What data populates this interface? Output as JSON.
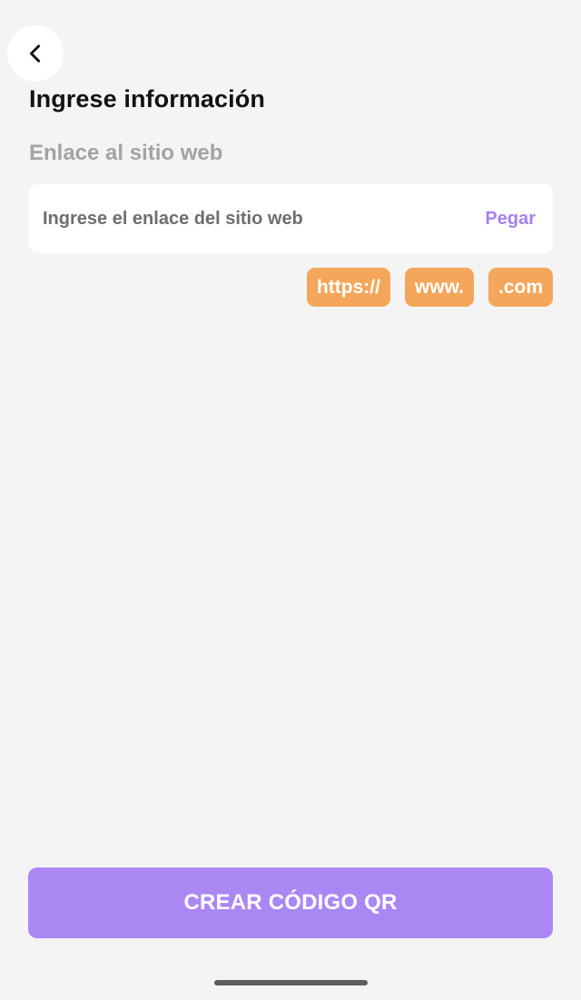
{
  "header": {
    "back_icon": "chevron-left-icon",
    "title": "Ingrese información"
  },
  "form": {
    "section_label": "Enlace al sitio web",
    "url_input": {
      "value": "",
      "placeholder": "Ingrese el enlace del sitio web"
    },
    "paste_label": "Pegar",
    "chips": [
      {
        "label": "https://"
      },
      {
        "label": "www."
      },
      {
        "label": ".com"
      }
    ]
  },
  "footer": {
    "create_label": "CREAR CÓDIGO QR"
  },
  "colors": {
    "background": "#f4f4f5",
    "accent_purple": "#ab87f4",
    "paste_purple": "#a97ff2",
    "chip_orange": "#f4a65a"
  }
}
